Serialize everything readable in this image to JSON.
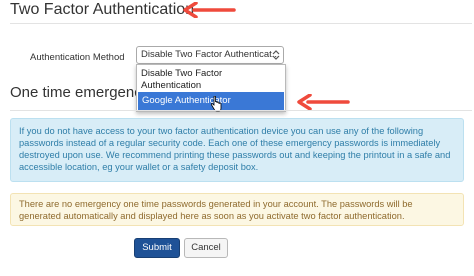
{
  "page_title": "Two Factor Authentication",
  "auth_method": {
    "label": "Authentication Method",
    "selected": "Disable Two Factor Authenticat...",
    "options": [
      "Disable Two Factor Authentication",
      "Google Authenticator"
    ],
    "highlighted_option": "Google Authenticator"
  },
  "section_title": "One time emergency",
  "info_text": "If you do not have access to your two factor authentication device you can use any of the following passwords instead of a regular security code. Each one of these emergency passwords is immediately destroyed upon use. We recommend printing these passwords out and keeping the printout in a safe and accessible location, eg your wallet or a safety deposit box.",
  "warning_text": "There are no emergency one time passwords generated in your account. The passwords will be generated automatically and displayed here as soon as you activate two factor authentication.",
  "buttons": {
    "submit": "Submit",
    "cancel": "Cancel"
  },
  "colors": {
    "annotation_arrow": "#ef4a3c",
    "highlight": "#3a78d6",
    "info_bg": "#d8edf7",
    "info_text": "#2f7ea8",
    "warn_bg": "#fcf7e3",
    "warn_text": "#8f6b2e",
    "submit_bg": "#1f5297"
  },
  "icons": [
    "annotation-arrow-icon",
    "chevron-updown-icon",
    "hand-cursor-icon"
  ]
}
